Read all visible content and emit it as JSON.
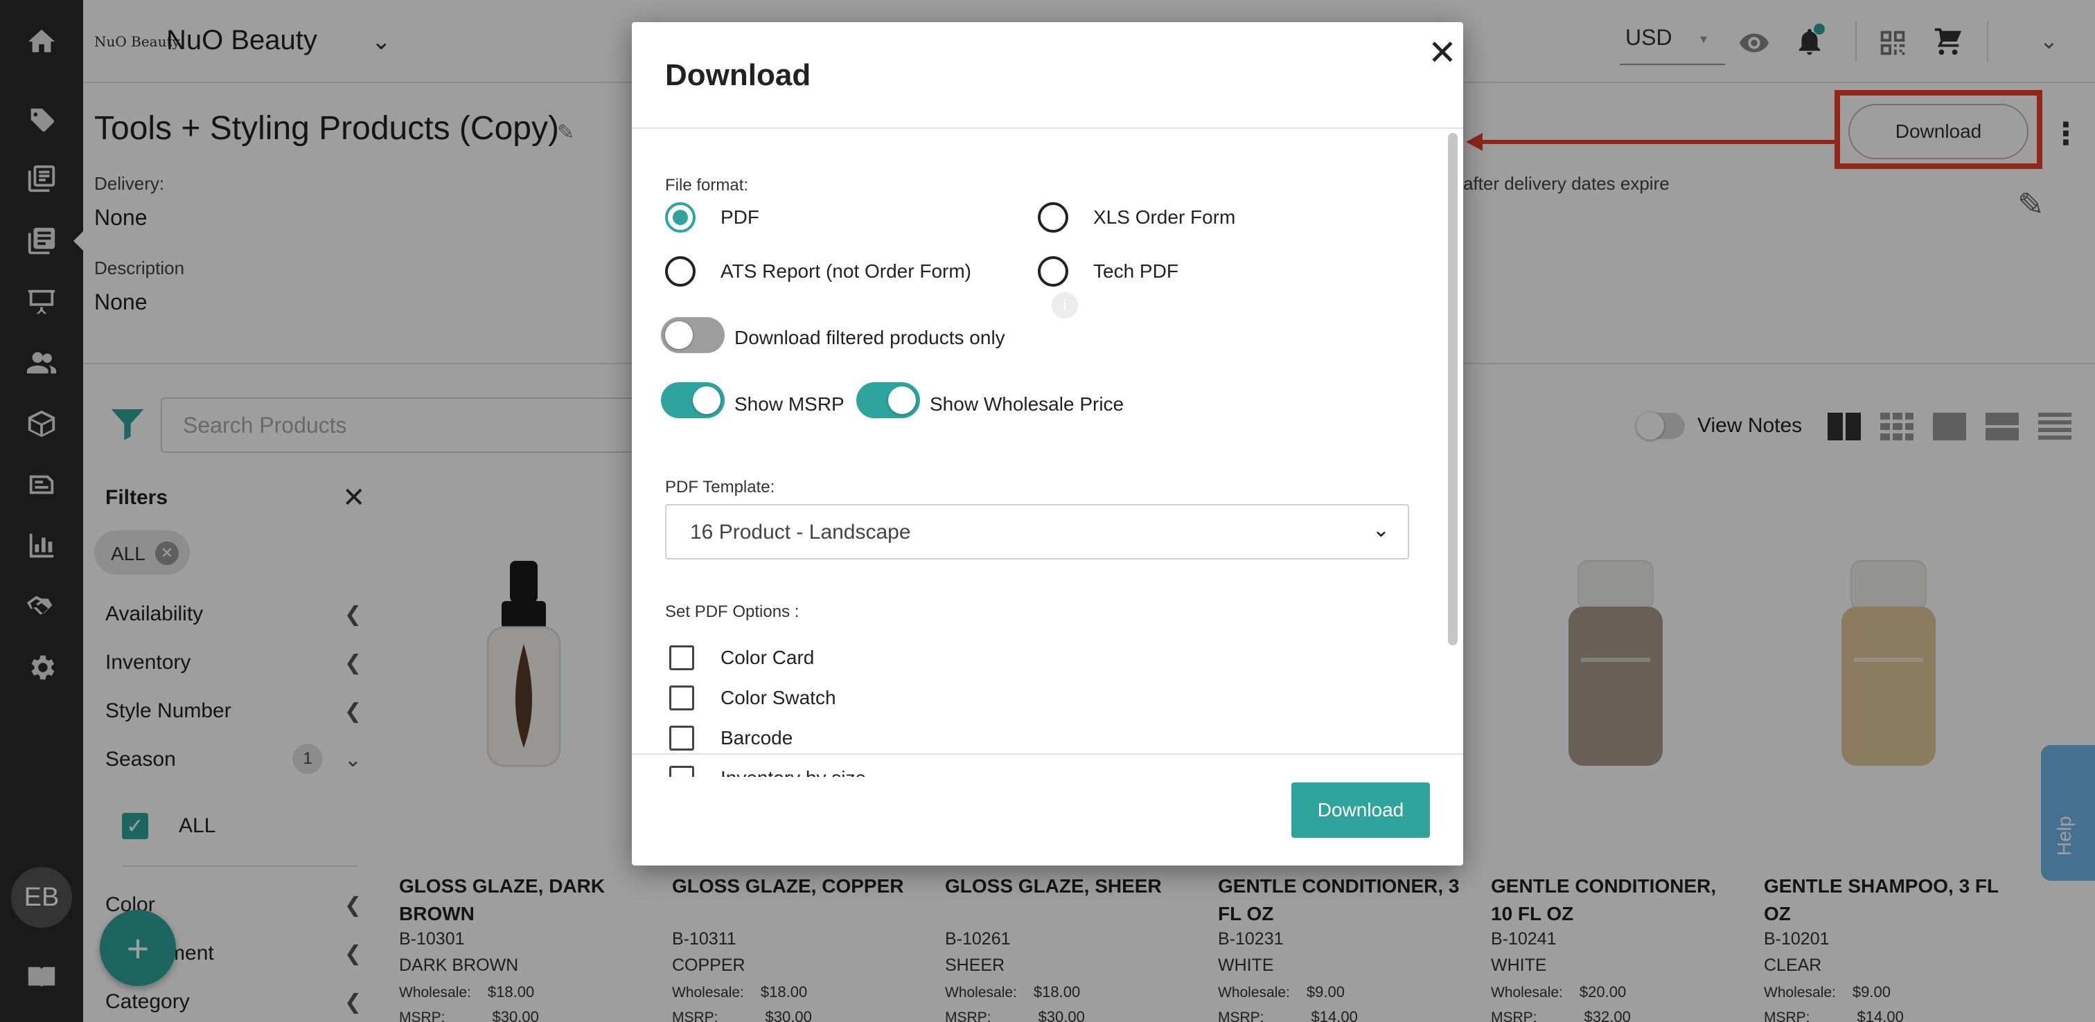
{
  "app": {
    "brand_logo": "NuO Beauty",
    "brand_name": "NuO Beauty",
    "currency": "USD",
    "avatar_initials": "EB"
  },
  "page": {
    "title": "Tools + Styling Products (Copy)",
    "delivery_label": "Delivery:",
    "delivery_value": "None",
    "description_label": "Description",
    "description_value": "None",
    "delivery_note": "after delivery dates expire",
    "download_label": "Download"
  },
  "toolbar": {
    "search_placeholder": "Search Products",
    "view_notes_label": "View Notes"
  },
  "filters": {
    "title": "Filters",
    "chip": "ALL",
    "rows": [
      "Availability",
      "Inventory",
      "Style Number",
      "Season",
      "Color",
      "Department",
      "Category"
    ],
    "season_count": "1",
    "season_option": "ALL"
  },
  "products": [
    {
      "name": "GLOSS GLAZE, DARK BROWN",
      "sku": "B-10301",
      "color": "DARK BROWN",
      "wholesale_label": "Wholesale:",
      "wholesale": "$18.00",
      "msrp_label": "MSRP:",
      "msrp": "$30.00",
      "bottle": "dropper",
      "tint": "#5a3a2a"
    },
    {
      "name": "GLOSS GLAZE, COPPER",
      "sku": "B-10311",
      "color": "COPPER",
      "wholesale_label": "Wholesale:",
      "wholesale": "$18.00",
      "msrp_label": "MSRP:",
      "msrp": "$30.00",
      "bottle": "dropper",
      "tint": "#b06a3a"
    },
    {
      "name": "GLOSS GLAZE, SHEER",
      "sku": "B-10261",
      "color": "SHEER",
      "wholesale_label": "Wholesale:",
      "wholesale": "$18.00",
      "msrp_label": "MSRP:",
      "msrp": "$30.00",
      "bottle": "dropper",
      "tint": "#d8cfc4"
    },
    {
      "name": "GENTLE CONDITIONER, 3 FL OZ",
      "sku": "B-10231",
      "color": "WHITE",
      "wholesale_label": "Wholesale:",
      "wholesale": "$9.00",
      "msrp_label": "MSRP:",
      "msrp": "$14.00",
      "bottle": "tube",
      "tint": "#b5a89a"
    },
    {
      "name": "GENTLE CONDITIONER, 10 FL OZ",
      "sku": "B-10241",
      "color": "WHITE",
      "wholesale_label": "Wholesale:",
      "wholesale": "$20.00",
      "msrp_label": "MSRP:",
      "msrp": "$32.00",
      "bottle": "tube",
      "tint": "#a89a8c"
    },
    {
      "name": "GENTLE SHAMPOO, 3 FL OZ",
      "sku": "B-10201",
      "color": "CLEAR",
      "wholesale_label": "Wholesale:",
      "wholesale": "$9.00",
      "msrp_label": "MSRP:",
      "msrp": "$14.00",
      "bottle": "tube",
      "tint": "#e3c89a"
    }
  ],
  "help_label": "Help",
  "modal": {
    "title": "Download",
    "file_format_label": "File format:",
    "formats": [
      {
        "label": "PDF",
        "checked": true
      },
      {
        "label": "XLS Order Form",
        "checked": false
      },
      {
        "label": "ATS Report (not Order Form)",
        "checked": false
      },
      {
        "label": "Tech PDF",
        "checked": false
      }
    ],
    "filtered_only_label": "Download filtered products only",
    "filtered_only_on": false,
    "show_msrp_label": "Show MSRP",
    "show_msrp_on": true,
    "show_wholesale_label": "Show Wholesale Price",
    "show_wholesale_on": true,
    "pdf_template_label": "PDF Template:",
    "pdf_template_value": "16 Product - Landscape",
    "pdf_options_label": "Set PDF Options :",
    "pdf_options": [
      "Color Card",
      "Color Swatch",
      "Barcode",
      "Inventory by size"
    ],
    "download_button": "Download"
  },
  "colors": {
    "accent": "#2fa49c",
    "sidebar": "#2a2a2a",
    "annotation": "#e8402a"
  }
}
